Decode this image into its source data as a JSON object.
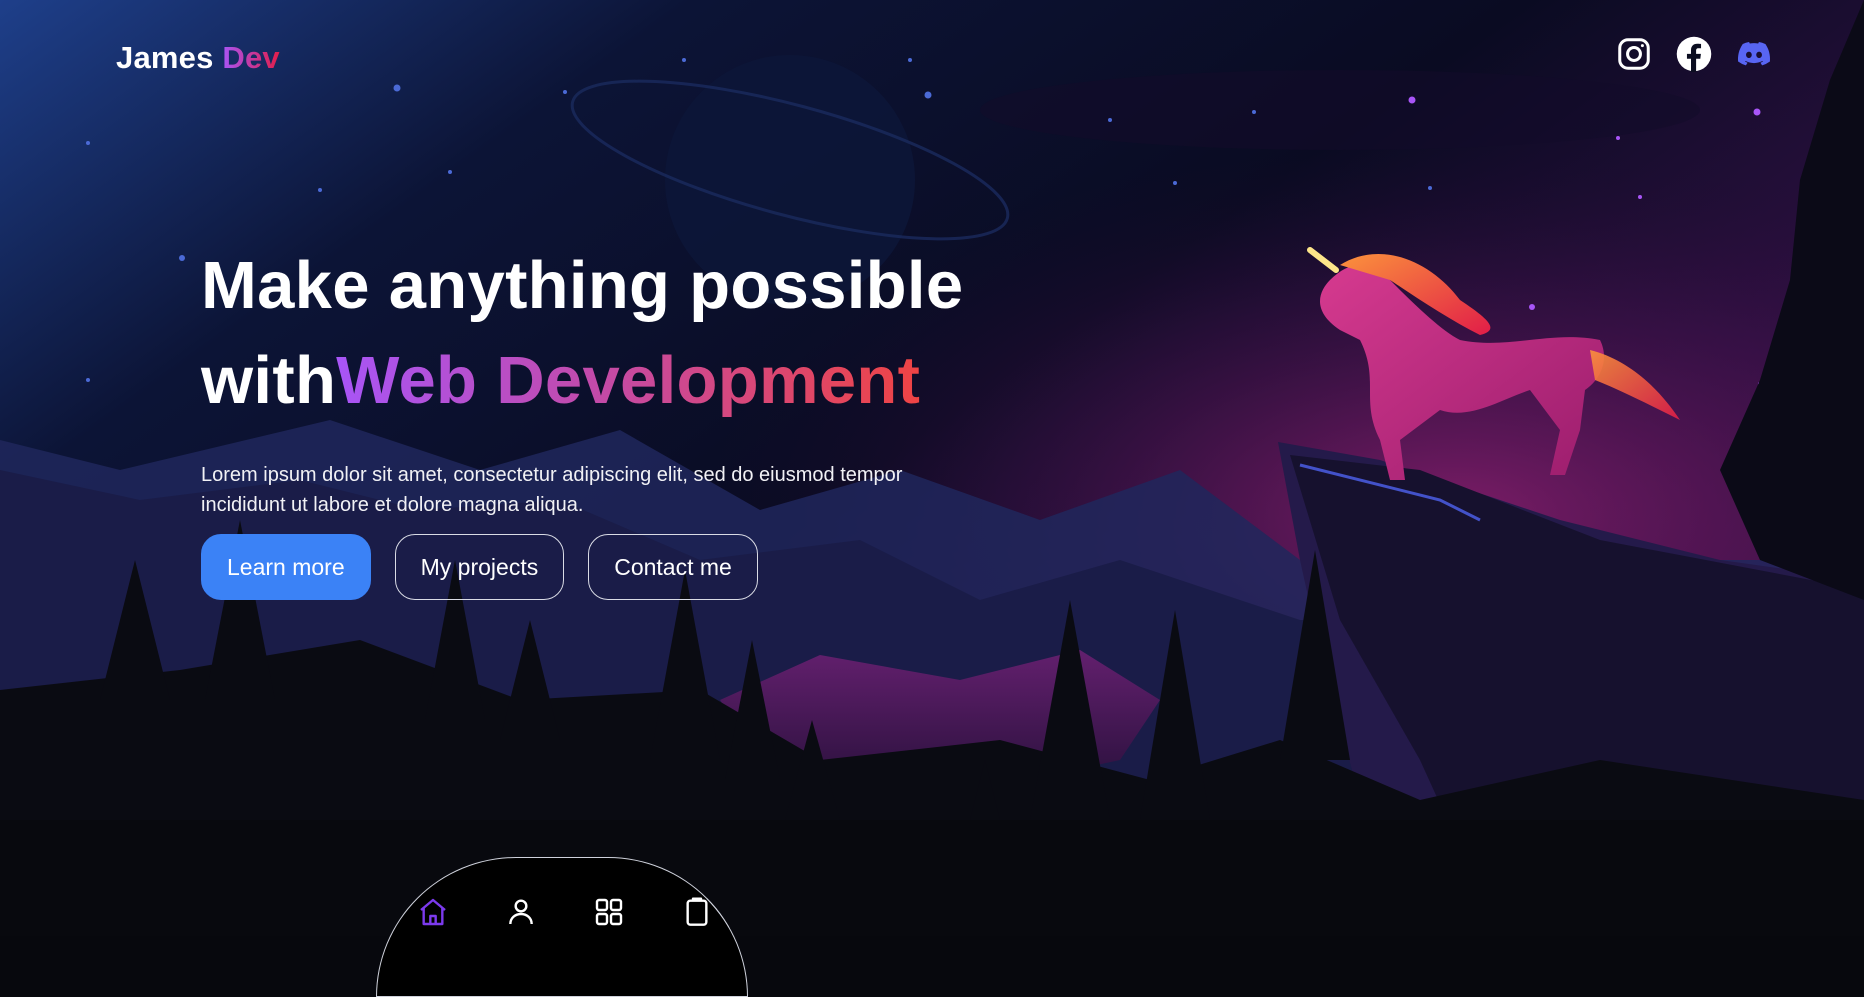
{
  "brand": {
    "name": "James",
    "accent": "Dev"
  },
  "socials": [
    {
      "icon": "instagram-icon"
    },
    {
      "icon": "facebook-icon"
    },
    {
      "icon": "discord-icon"
    }
  ],
  "hero": {
    "line1": "Make anything possible",
    "line2_plain": "with",
    "line2_gradient": "Web Development",
    "description": "Lorem ipsum dolor sit amet, consectetur adipiscing elit, sed do eiusmod tempor incididunt ut labore et dolore magna aliqua."
  },
  "buttons": {
    "learn_more": "Learn more",
    "projects": "My projects",
    "contact": "Contact me"
  },
  "dock": {
    "items": [
      {
        "icon": "home-icon",
        "active": true
      },
      {
        "icon": "user-icon",
        "active": false
      },
      {
        "icon": "grid-icon",
        "active": false
      },
      {
        "icon": "clipboard-icon",
        "active": false
      }
    ]
  },
  "colors": {
    "primary_button": "#3b82f6",
    "gradient_start": "#a855f7",
    "gradient_end": "#ef4444",
    "discord": "#5865f2",
    "active_dock": "#7c3aed"
  }
}
